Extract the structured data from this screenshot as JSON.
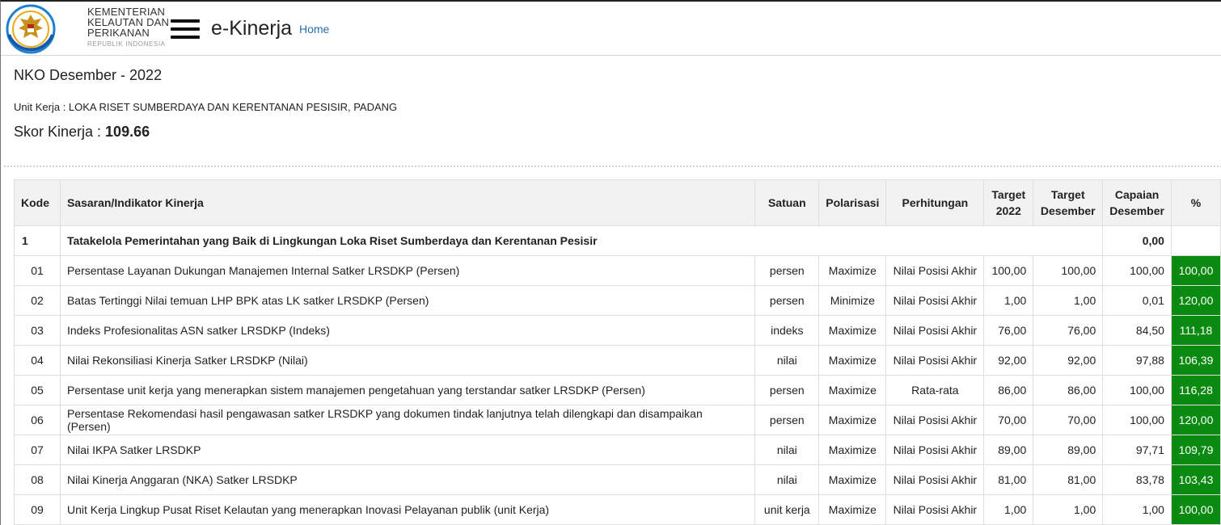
{
  "header": {
    "logo_lines": [
      "KEMENTERIAN",
      "KELAUTAN DAN",
      "PERIKANAN"
    ],
    "logo_sub": "REPUBLIK INDONESIA",
    "app_name": "e-Kinerja",
    "nav_home": "Home"
  },
  "page": {
    "title": "NKO Desember - 2022",
    "unit_kerja_label": "Unit Kerja : ",
    "unit_kerja_value": "LOKA RISET SUMBERDAYA DAN KERENTANAN PESISIR, PADANG",
    "skor_label": "Skor Kinerja : ",
    "skor_value": "109.66"
  },
  "table": {
    "headers": {
      "kode": "Kode",
      "indikator": "Sasaran/Indikator Kinerja",
      "satuan": "Satuan",
      "polarisasi": "Polarisasi",
      "perhitungan": "Perhitungan",
      "target_2022": [
        "Target",
        "2022"
      ],
      "target_desember": [
        "Target",
        "Desember"
      ],
      "capaian_desember": [
        "Capaian",
        "Desember"
      ],
      "persen": "%"
    },
    "group": {
      "kode": "1",
      "name": "Tatakelola Pemerintahan yang Baik di Lingkungan Loka Riset Sumberdaya dan Kerentanan Pesisir",
      "capaian": "0,00"
    },
    "rows": [
      {
        "kode": "01",
        "name": "Persentase Layanan Dukungan Manajemen Internal Satker LRSDKP (Persen)",
        "satuan": "persen",
        "polarisasi": "Maximize",
        "perhitungan": "Nilai Posisi Akhir",
        "target_2022": "100,00",
        "target_des": "100,00",
        "capaian": "100,00",
        "persen": "100,00"
      },
      {
        "kode": "02",
        "name": "Batas Tertinggi Nilai temuan LHP BPK atas LK satker LRSDKP (Persen)",
        "satuan": "persen",
        "polarisasi": "Minimize",
        "perhitungan": "Nilai Posisi Akhir",
        "target_2022": "1,00",
        "target_des": "1,00",
        "capaian": "0,01",
        "persen": "120,00"
      },
      {
        "kode": "03",
        "name": "Indeks Profesionalitas ASN satker LRSDKP (Indeks)",
        "satuan": "indeks",
        "polarisasi": "Maximize",
        "perhitungan": "Nilai Posisi Akhir",
        "target_2022": "76,00",
        "target_des": "76,00",
        "capaian": "84,50",
        "persen": "111,18"
      },
      {
        "kode": "04",
        "name": "Nilai Rekonsiliasi Kinerja Satker LRSDKP (Nilai)",
        "satuan": "nilai",
        "polarisasi": "Maximize",
        "perhitungan": "Nilai Posisi Akhir",
        "target_2022": "92,00",
        "target_des": "92,00",
        "capaian": "97,88",
        "persen": "106,39"
      },
      {
        "kode": "05",
        "name": "Persentase unit kerja yang menerapkan sistem manajemen pengetahuan yang terstandar satker LRSDKP (Persen)",
        "satuan": "persen",
        "polarisasi": "Maximize",
        "perhitungan": "Rata-rata",
        "target_2022": "86,00",
        "target_des": "86,00",
        "capaian": "100,00",
        "persen": "116,28"
      },
      {
        "kode": "06",
        "name": "Persentase Rekomendasi hasil pengawasan satker LRSDKP yang dokumen tindak lanjutnya telah dilengkapi dan disampaikan (Persen)",
        "satuan": "persen",
        "polarisasi": "Maximize",
        "perhitungan": "Nilai Posisi Akhir",
        "target_2022": "70,00",
        "target_des": "70,00",
        "capaian": "100,00",
        "persen": "120,00"
      },
      {
        "kode": "07",
        "name": "Nilai IKPA Satker LRSDKP",
        "satuan": "nilai",
        "polarisasi": "Maximize",
        "perhitungan": "Nilai Posisi Akhir",
        "target_2022": "89,00",
        "target_des": "89,00",
        "capaian": "97,71",
        "persen": "109,79"
      },
      {
        "kode": "08",
        "name": "Nilai Kinerja Anggaran (NKA) Satker LRSDKP",
        "satuan": "nilai",
        "polarisasi": "Maximize",
        "perhitungan": "Nilai Posisi Akhir",
        "target_2022": "81,00",
        "target_des": "81,00",
        "capaian": "83,78",
        "persen": "103,43"
      },
      {
        "kode": "09",
        "name": "Unit Kerja Lingkup Pusat Riset Kelautan yang menerapkan Inovasi Pelayanan publik (unit Kerja)",
        "satuan": "unit kerja",
        "polarisasi": "Maximize",
        "perhitungan": "Nilai Posisi Akhir",
        "target_2022": "1,00",
        "target_des": "1,00",
        "capaian": "1,00",
        "persen": "100,00"
      }
    ]
  },
  "colors": {
    "percent_cell_bg": "#0b8a12",
    "link": "#2a6ead",
    "header_bg": "#f2f2f2"
  },
  "icons": {
    "logo": "kkp-emblem-icon",
    "menu": "hamburger-menu-icon"
  }
}
